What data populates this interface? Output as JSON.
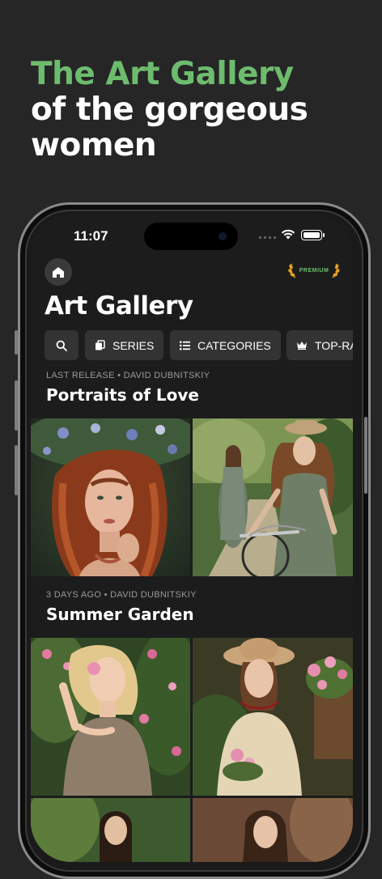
{
  "promo": {
    "headline_accent": "The Art Gallery",
    "headline_line2": "of the gorgeous",
    "headline_line3": "women"
  },
  "status_bar": {
    "time": "11:07"
  },
  "header": {
    "premium_label": "PREMIUM",
    "title": "Art Gallery"
  },
  "filters": [
    {
      "label": "SERIES",
      "icon": "series-icon"
    },
    {
      "label": "CATEGORIES",
      "icon": "list-icon"
    },
    {
      "label": "TOP-RA",
      "icon": "crown-icon"
    }
  ],
  "sections": [
    {
      "meta": "LAST RELEASE • DAVID DUBNITSKIY",
      "title": "Portraits of Love"
    },
    {
      "meta": "3 DAYS AGO • DAVID DUBNITSKIY",
      "title": "Summer Garden"
    }
  ],
  "colors": {
    "accent": "#6dbc6e",
    "background": "#262626",
    "chip": "#333333",
    "premium_laurel": "#e8a21c"
  }
}
